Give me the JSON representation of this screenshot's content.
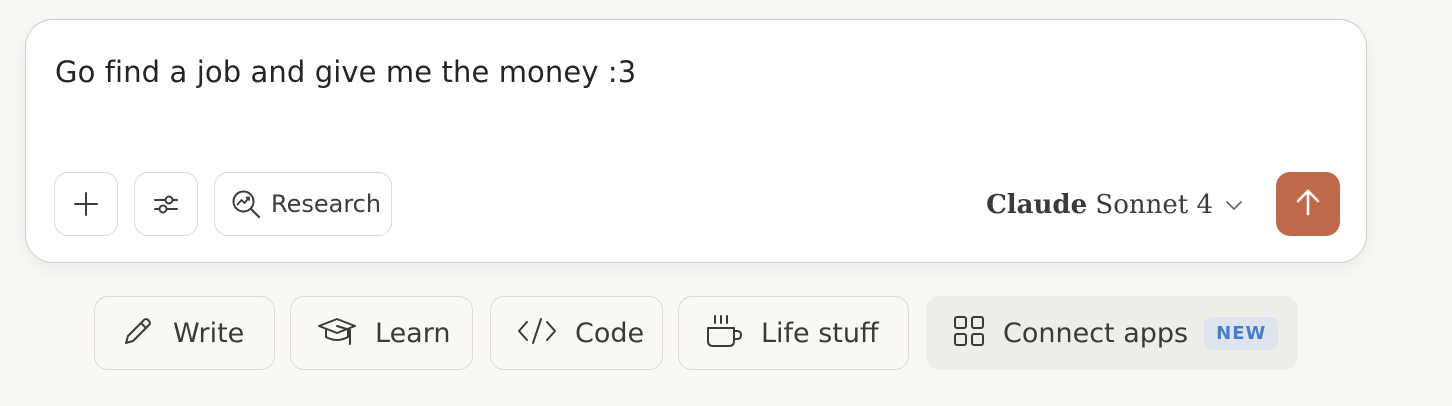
{
  "composer": {
    "prompt_text": "Go find a job and give me the money :3",
    "add_button_icon": "plus-icon",
    "tools_button_icon": "sliders-icon",
    "research_button": {
      "label": "Research",
      "icon": "research-magnifier-icon"
    },
    "model_selector": {
      "brand": "Claude",
      "model": "Sonnet 4",
      "icon": "chevron-down-icon"
    },
    "send_button": {
      "icon": "arrow-up-icon",
      "color": "#c0694a"
    }
  },
  "suggestions": [
    {
      "label": "Write",
      "icon": "pencil-icon"
    },
    {
      "label": "Learn",
      "icon": "graduation-cap-icon"
    },
    {
      "label": "Code",
      "icon": "code-icon"
    },
    {
      "label": "Life stuff",
      "icon": "coffee-cup-icon"
    },
    {
      "label": "Connect apps",
      "icon": "grid-apps-icon",
      "badge": "NEW",
      "badge_color": "#4a7bc9"
    }
  ],
  "colors": {
    "background": "#f9f8f5",
    "accent": "#c0694a"
  }
}
